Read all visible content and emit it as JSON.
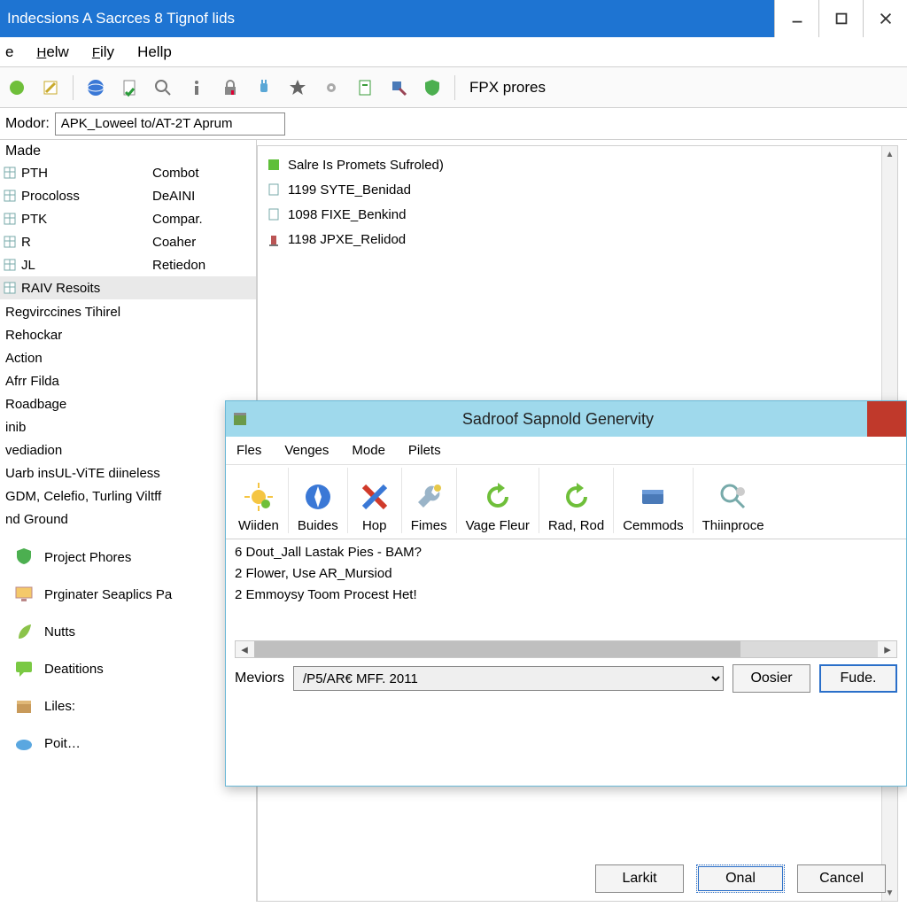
{
  "window": {
    "title": "Indecsions A Sacrces 8 Tignof lids"
  },
  "menu": {
    "items": [
      "e",
      "Helw",
      "Fily",
      "Hellp"
    ],
    "underline": [
      null,
      0,
      0,
      null
    ]
  },
  "toolbar": {
    "icons": [
      "leaf-icon",
      "edit-icon",
      "globe-icon",
      "doc-check-icon",
      "search-icon",
      "info-icon",
      "lock-icon",
      "plug-icon",
      "star-icon",
      "gear-icon",
      "page-icon",
      "brush-icon",
      "shield-icon"
    ],
    "label": "FPX prores"
  },
  "addr": {
    "label": "Modor:",
    "value": "APK_Loweel to/AT-2T Aprum"
  },
  "left": {
    "made": "Made",
    "grid": [
      {
        "icon": "col",
        "c1": "PTH",
        "c2": "Combot"
      },
      {
        "icon": "col",
        "c1": "Procoloss",
        "c2": "DeAINI"
      },
      {
        "icon": "col",
        "c1": "PTK",
        "c2": "Compar."
      },
      {
        "icon": "col",
        "c1": "R",
        "c2": "Coaher"
      },
      {
        "icon": "col",
        "c1": "JL",
        "c2": "Retiedon"
      },
      {
        "icon": "sel",
        "c1": "RAIV Resoits",
        "c2": ""
      }
    ],
    "tree": [
      "Regvirccines Tihirel",
      "Rehockar",
      "Action",
      "Afrr Filda",
      "Roadbage",
      "inib",
      "vediadion",
      "Uarb insUL-ViTE diineless",
      "GDM, Celefio, Turling Viltff",
      "nd Ground"
    ],
    "nav": [
      {
        "icon": "shield-green",
        "label": "Project Phores"
      },
      {
        "icon": "monitor",
        "label": "Prginater Seaplics Pa"
      },
      {
        "icon": "leaf",
        "label": "Nutts"
      },
      {
        "icon": "chat",
        "label": "Deatitions"
      },
      {
        "icon": "box",
        "label": "Liles:"
      },
      {
        "icon": "cloud",
        "label": "Poit…"
      }
    ]
  },
  "right": {
    "items": [
      {
        "icon": "green",
        "text": "Salre Is Promets Sufroled)"
      },
      {
        "icon": "doc",
        "text": "1199 SYTE_Benidad"
      },
      {
        "icon": "doc",
        "text": "1098 FIXE_Benkind"
      },
      {
        "icon": "tower",
        "text": "1198 JPXE_Relidod"
      }
    ]
  },
  "main_buttons": {
    "larkit": "Larkit",
    "onal": "Onal",
    "cancel": "Cancel"
  },
  "dialog": {
    "title": "Sadroof Sapnold Genervity",
    "menu": [
      "Fles",
      "Venges",
      "Mode",
      "Pilets"
    ],
    "tools": [
      {
        "icon": "sun",
        "label": "Wiiden"
      },
      {
        "icon": "compass",
        "label": "Buides"
      },
      {
        "icon": "cross",
        "label": "Hop"
      },
      {
        "icon": "wrench",
        "label": "Fimes"
      },
      {
        "icon": "refresh",
        "label": "Vage Fleur"
      },
      {
        "icon": "refresh2",
        "label": "Rad, Rod"
      },
      {
        "icon": "drive",
        "label": "Cemmods"
      },
      {
        "icon": "mag",
        "label": "Thiinproce"
      }
    ],
    "body": [
      "6 Dout_Jall Lastak Pies - BAM?",
      "2 Flower, Use AR_Mursiod",
      "2 Emmoysy Toom Procest Het!"
    ],
    "meviors_label": "Meviors",
    "meviors_value": "/P5/AR€ MFF. 2011",
    "btn_oosier": "Oosier",
    "btn_fude": "Fude."
  }
}
